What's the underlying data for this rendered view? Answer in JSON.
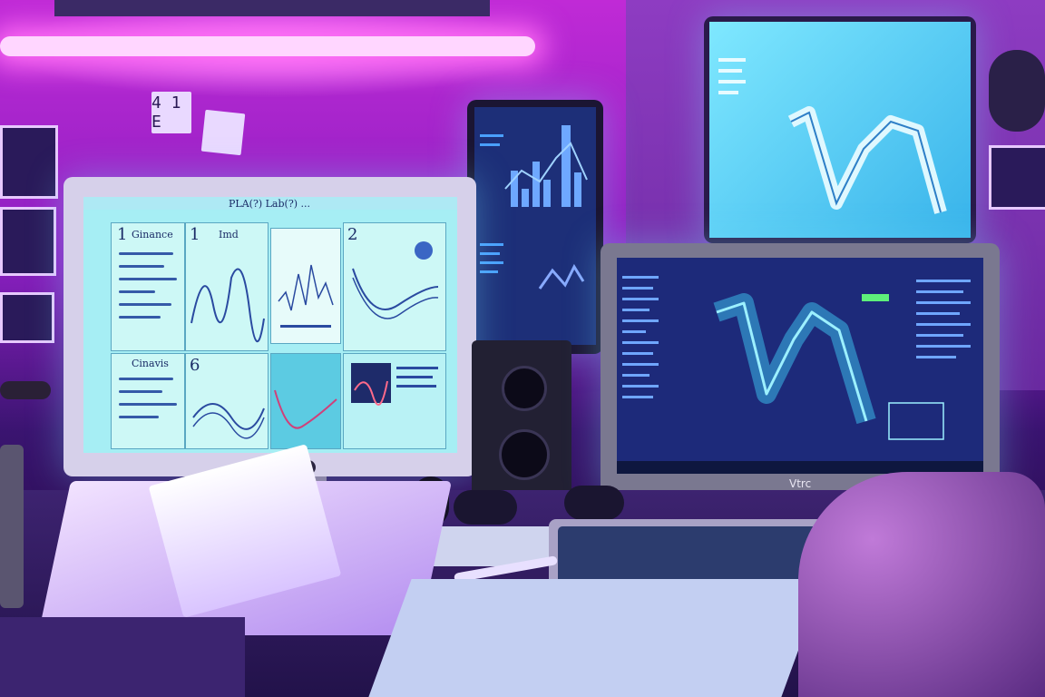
{
  "scene": "desk with monitors in purple neon-lit room",
  "sticky_notes": [
    {
      "text": "4 1 E"
    },
    {
      "text": ""
    }
  ],
  "left_monitor": {
    "title_bar": "PLA(?) Lab(?) ...",
    "panels": [
      {
        "number": "1",
        "heading": "Ginance"
      },
      {
        "number": "1",
        "heading": "Imd"
      },
      {
        "number": "2",
        "heading": ""
      },
      {
        "number": "6",
        "heading": "Cinavis"
      }
    ],
    "brand": "Apple logo"
  },
  "right_monitor": {
    "brand_label": "Vtrc"
  },
  "colors": {
    "neon_pink": "#ff4cf0",
    "screen_cyan": "#cdf8f6",
    "blueprint_blue": "#1d2a7a",
    "accent_purple": "#8a1fc0"
  }
}
